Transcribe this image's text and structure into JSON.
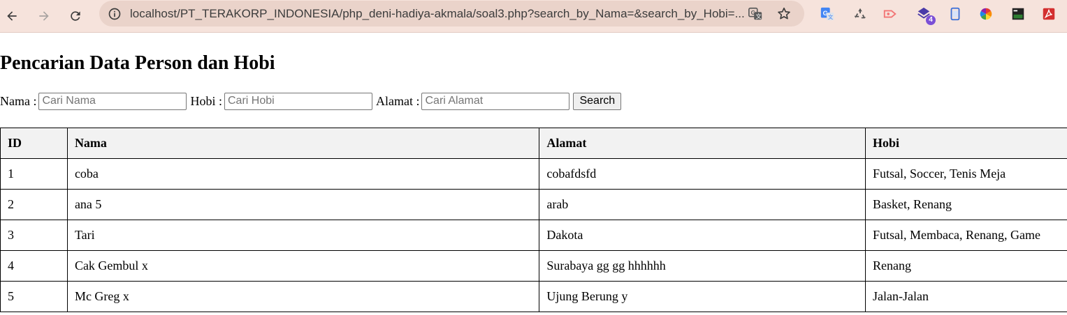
{
  "browser": {
    "url": "localhost/PT_TERAKORP_INDONESIA/php_deni-hadiya-akmala/soal3.php?search_by_Nama=&search_by_Hobi=...",
    "extension_badge": "4"
  },
  "page": {
    "title": "Pencarian Data Person dan Hobi",
    "search": {
      "nama_label": "Nama :",
      "nama_placeholder": "Cari Nama",
      "hobi_label": "Hobi :",
      "hobi_placeholder": "Cari Hobi",
      "alamat_label": "Alamat :",
      "alamat_placeholder": "Cari Alamat",
      "button_label": "Search"
    },
    "table": {
      "headers": [
        "ID",
        "Nama",
        "Alamat",
        "Hobi"
      ],
      "rows": [
        [
          "1",
          "coba",
          "cobafdsfd",
          "Futsal, Soccer, Tenis Meja"
        ],
        [
          "2",
          "ana 5",
          "arab",
          "Basket, Renang"
        ],
        [
          "3",
          "Tari",
          "Dakota",
          "Futsal, Membaca, Renang, Game"
        ],
        [
          "4",
          "Cak Gembul x",
          "Surabaya gg gg hhhhhh",
          "Renang"
        ],
        [
          "5",
          "Mc Greg x",
          "Ujung Berung y",
          "Jalan-Jalan"
        ]
      ]
    }
  }
}
